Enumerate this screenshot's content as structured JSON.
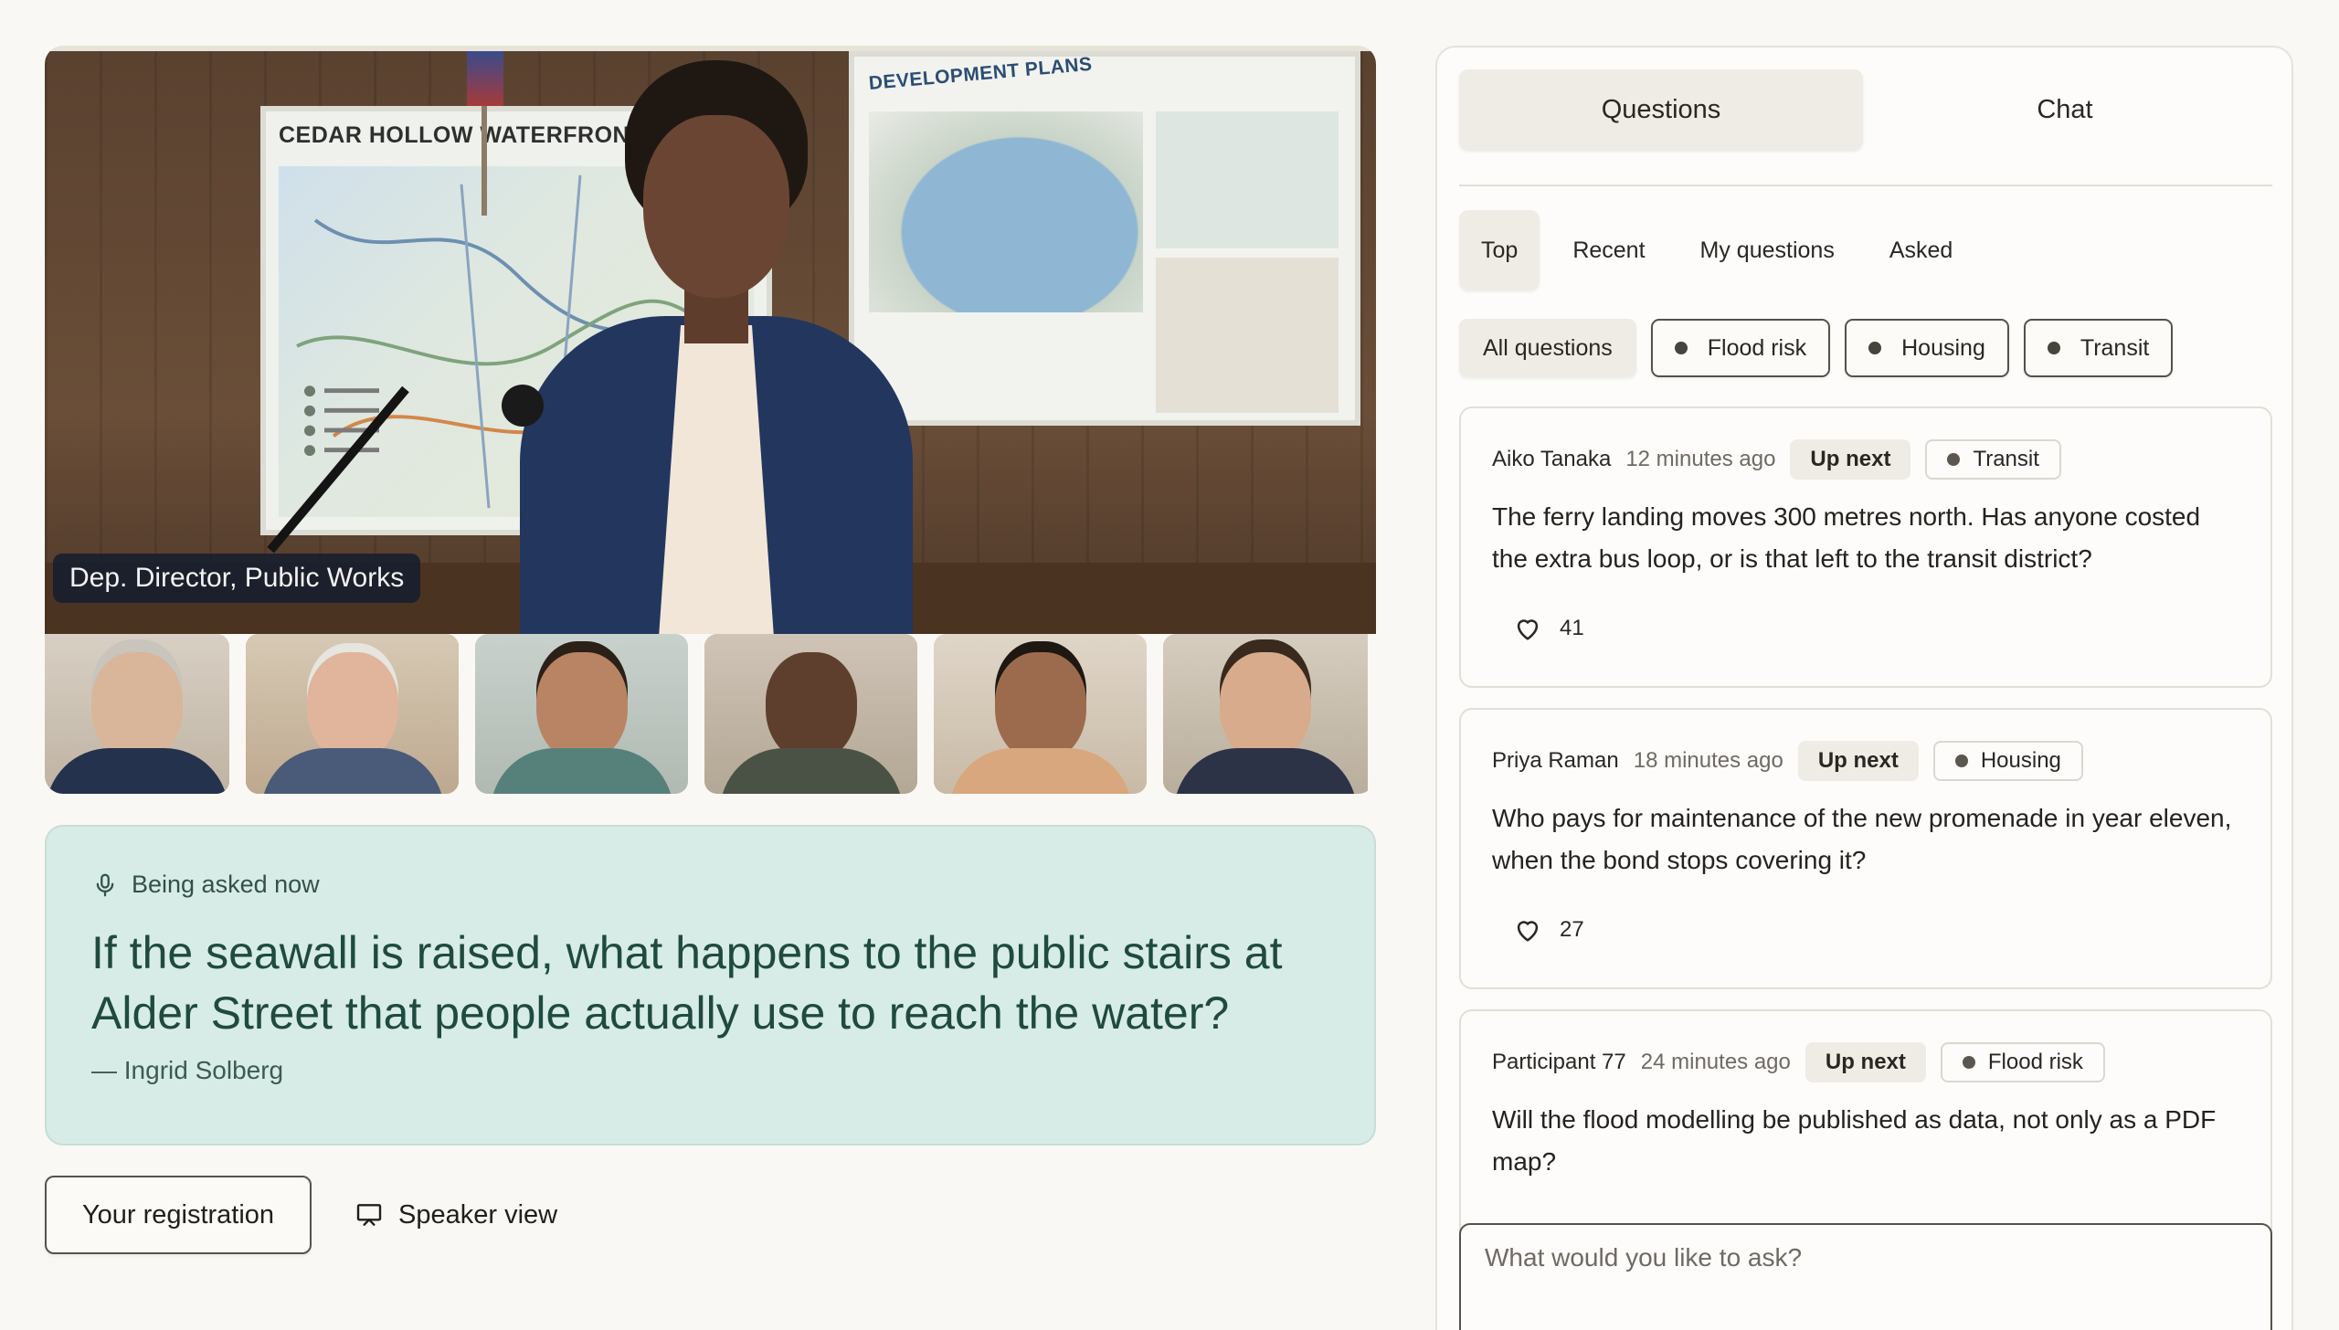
{
  "stage": {
    "board_left_title": "CEDAR HOLLOW WATERFRONT PLAN",
    "board_right_title": "DEVELOPMENT PLANS",
    "speaker_caption": "Dep. Director, Public Works"
  },
  "now": {
    "label": "Being asked now",
    "question": "If the seawall is raised, what happens to the public stairs at Alder Street that people actually use to reach the water?",
    "author": "— Ingrid Solberg"
  },
  "actions": {
    "registration": "Your registration",
    "speaker_view": "Speaker view"
  },
  "panel": {
    "tabs": [
      "Questions",
      "Chat"
    ],
    "sub_tabs": [
      "Top",
      "Recent",
      "My questions",
      "Asked"
    ],
    "filters": [
      "All questions",
      "Flood risk",
      "Housing",
      "Transit"
    ],
    "questions": [
      {
        "author": "Aiko Tanaka",
        "time": "12 minutes ago",
        "status": "Up next",
        "topic": "Transit",
        "text": "The ferry landing moves 300 metres north. Has anyone costed the extra bus loop, or is that left to the transit district?",
        "votes": "41"
      },
      {
        "author": "Priya Raman",
        "time": "18 minutes ago",
        "status": "Up next",
        "topic": "Housing",
        "text": "Who pays for maintenance of the new promenade in year eleven, when the bond stops covering it?",
        "votes": "27"
      },
      {
        "author": "Participant 77",
        "time": "24 minutes ago",
        "status": "Up next",
        "topic": "Flood risk",
        "text": "Will the flood modelling be published as data, not only as a PDF map?",
        "votes": ""
      }
    ],
    "ask_placeholder": "What would you like to ask?"
  },
  "colors": {
    "now_card_bg": "#d7ece6",
    "active_thumb_outline": "#d9a441",
    "page_bg": "#faf8f4"
  }
}
